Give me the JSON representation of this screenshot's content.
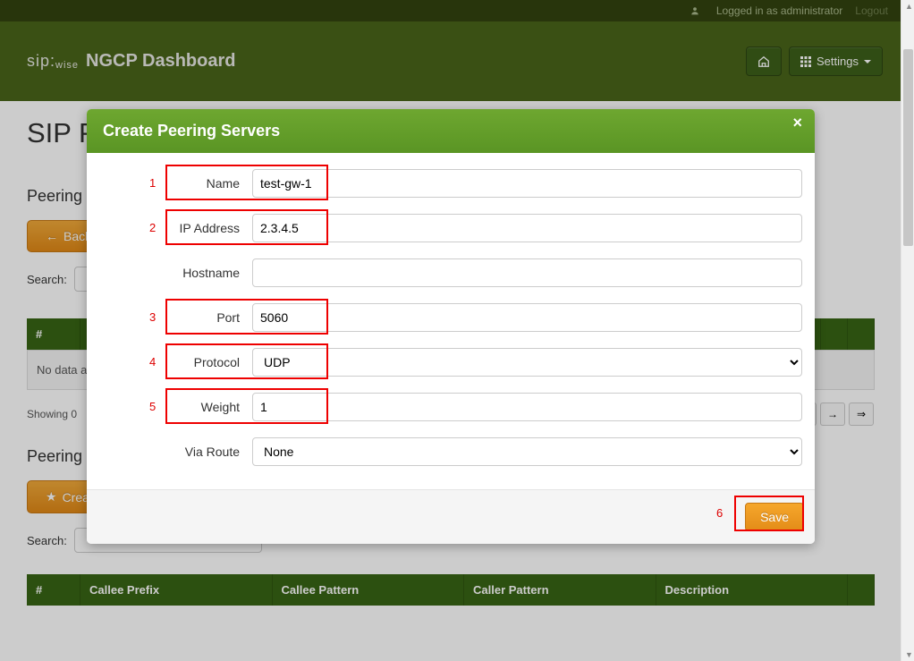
{
  "topbar": {
    "login_text": "Logged in as administrator",
    "logout_label": "Logout"
  },
  "header": {
    "brand_prefix": "sip:",
    "brand_suffix": "wise",
    "title": "NGCP Dashboard",
    "settings_label": "Settings"
  },
  "page": {
    "title": "SIP Pe",
    "section_peering_1": "Peering",
    "back_label": "Back",
    "search_label": "Search:",
    "table_hash": "#",
    "table_empty": "No data a",
    "pager_info": "Showing 0 ",
    "section_peering_2": "Peering",
    "create_label": "Crea",
    "table2_cols": [
      "#",
      "Callee Prefix",
      "Callee Pattern",
      "Caller Pattern",
      "Description"
    ]
  },
  "modal": {
    "title": "Create Peering Servers",
    "fields": {
      "name": {
        "label": "Name",
        "value": "test-gw-1",
        "annot": "1"
      },
      "ip": {
        "label": "IP Address",
        "value": "2.3.4.5",
        "annot": "2"
      },
      "host": {
        "label": "Hostname",
        "value": ""
      },
      "port": {
        "label": "Port",
        "value": "5060",
        "annot": "3"
      },
      "proto": {
        "label": "Protocol",
        "value": "UDP",
        "annot": "4"
      },
      "weight": {
        "label": "Weight",
        "value": "1",
        "annot": "5"
      },
      "via": {
        "label": "Via Route",
        "value": "None"
      }
    },
    "save_label": "Save",
    "save_annot": "6"
  }
}
